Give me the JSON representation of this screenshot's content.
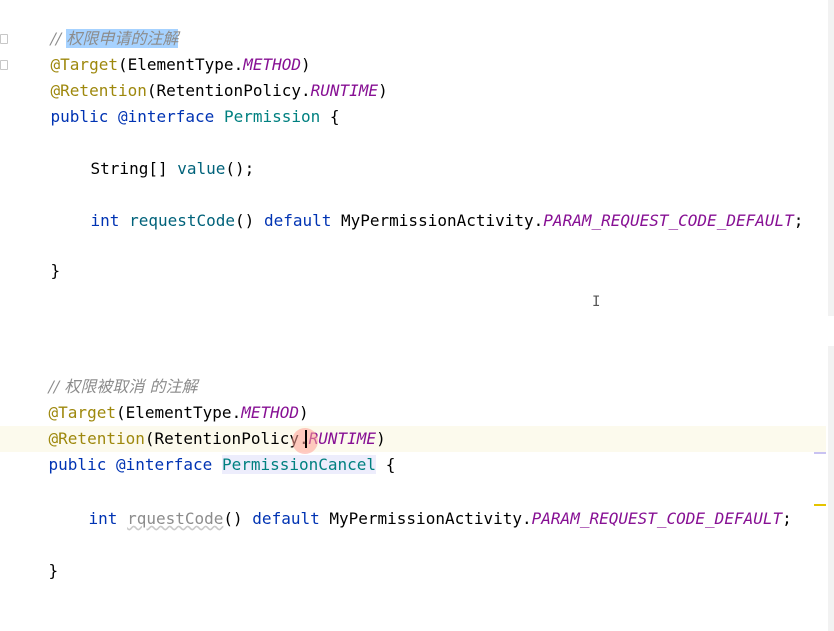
{
  "editor": {
    "top_snippet": {
      "comment": "// ",
      "comment_text": "权限申请的注解",
      "ann1_at": "@Target",
      "ann1_paren_open": "(ElementType.",
      "ann1_const": "METHOD",
      "ann1_paren_close": ")",
      "ann2_at": "@Retention",
      "ann2_paren_open": "(RetentionPolicy.",
      "ann2_const": "RUNTIME",
      "ann2_paren_close": ")",
      "decl_public": "public ",
      "decl_interface": "@interface ",
      "decl_name": "Permission",
      "decl_brace": " {",
      "value_type": "String[] ",
      "value_method": "value",
      "value_rest": "();",
      "rc_type": "int ",
      "rc_method": "requestCode",
      "rc_parens": "() ",
      "rc_default": "default ",
      "rc_class": "MyPermissionActivity.",
      "rc_const": "PARAM_REQUEST_CODE_DEFAULT",
      "rc_semicolon": ";",
      "close_brace": "}"
    },
    "bottom_snippet": {
      "comment": "// ",
      "comment_text": "权限被取消 的注解",
      "ann1_at": "@Target",
      "ann1_paren_open": "(ElementType.",
      "ann1_const": "METHOD",
      "ann1_paren_close": ")",
      "ann2_at": "@Retention",
      "ann2_paren_open": "(RetentionPolicy.",
      "ann2_const": "RUNTIME",
      "ann2_paren_close": ")",
      "decl_public": "public ",
      "decl_interface": "@interface ",
      "decl_name": "PermissionCancel",
      "decl_brace": " {",
      "rc_type": "int ",
      "rc_method": "rquestCode",
      "rc_parens": "() ",
      "rc_default": "default ",
      "rc_class": "MyPermissionActivity.",
      "rc_const": "PARAM_REQUEST_CODE_DEFAULT",
      "rc_semicolon": ";",
      "close_brace": "}"
    },
    "text_cursor_glyph": "I",
    "colors": {
      "keyword": "#0033b3",
      "annotation": "#9e880d",
      "constant": "#871094",
      "comment": "#8c8c8c",
      "method": "#00627a",
      "selection": "#a6d2ff",
      "current_line": "#fcfaed"
    }
  }
}
